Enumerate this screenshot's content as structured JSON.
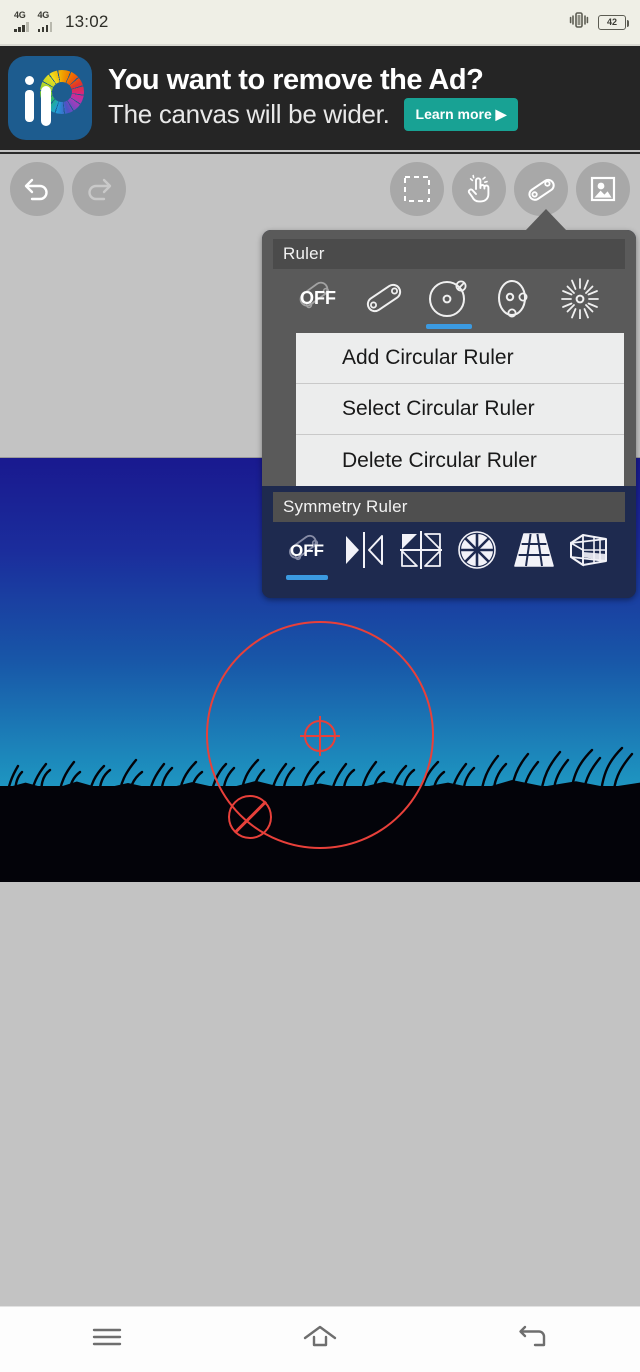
{
  "status_bar": {
    "time": "13:02",
    "network_1": "4G",
    "network_2": "4G",
    "battery_level": "42",
    "vibrate_icon": "vibrate-icon"
  },
  "ad": {
    "line1": "You want to remove the Ad?",
    "line2": "The canvas will be wider.",
    "cta": "Learn more ▶",
    "logo_alt": "ibispaint-logo"
  },
  "toolbar": {
    "undo": "undo-icon",
    "redo": "redo-icon",
    "select": "selection-icon",
    "hand": "hand-tool-icon",
    "ruler": "ruler-icon",
    "image": "image-icon"
  },
  "popup": {
    "ruler_section": {
      "title": "Ruler",
      "options": [
        {
          "name": "off",
          "label": "OFF",
          "selected": false
        },
        {
          "name": "line-ruler",
          "label": "",
          "selected": false
        },
        {
          "name": "circle-ruler",
          "label": "",
          "selected": true
        },
        {
          "name": "ellipse-ruler",
          "label": "",
          "selected": false
        },
        {
          "name": "radial-ruler",
          "label": "",
          "selected": false
        }
      ]
    },
    "menu": [
      {
        "label": "Add Circular Ruler"
      },
      {
        "label": "Select Circular Ruler"
      },
      {
        "label": "Delete Circular Ruler"
      }
    ],
    "symmetry_section": {
      "title": "Symmetry Ruler",
      "options": [
        {
          "name": "off",
          "label": "OFF",
          "selected": true
        },
        {
          "name": "mirror-symmetry",
          "label": "",
          "selected": false
        },
        {
          "name": "kaleidoscope-symmetry",
          "label": "",
          "selected": false
        },
        {
          "name": "radial-symmetry",
          "label": "",
          "selected": false
        },
        {
          "name": "perspective-grid-symmetry",
          "label": "",
          "selected": false
        },
        {
          "name": "box-grid-symmetry",
          "label": "",
          "selected": false
        }
      ]
    }
  },
  "canvas": {
    "artwork_description": "night sky gradient over black grass silhouette",
    "ruler_overlay_color": "#e8403a",
    "ruler_type": "circular"
  },
  "nav_bar": {
    "recents": "menu-icon",
    "home": "home-icon",
    "back": "back-icon"
  },
  "colors": {
    "accent": "#3b9ae1",
    "popup_navy": "#1e2a4f",
    "popup_gray": "#5a5a5a",
    "cta": "#18a294",
    "ruler_red": "#e8403a"
  }
}
